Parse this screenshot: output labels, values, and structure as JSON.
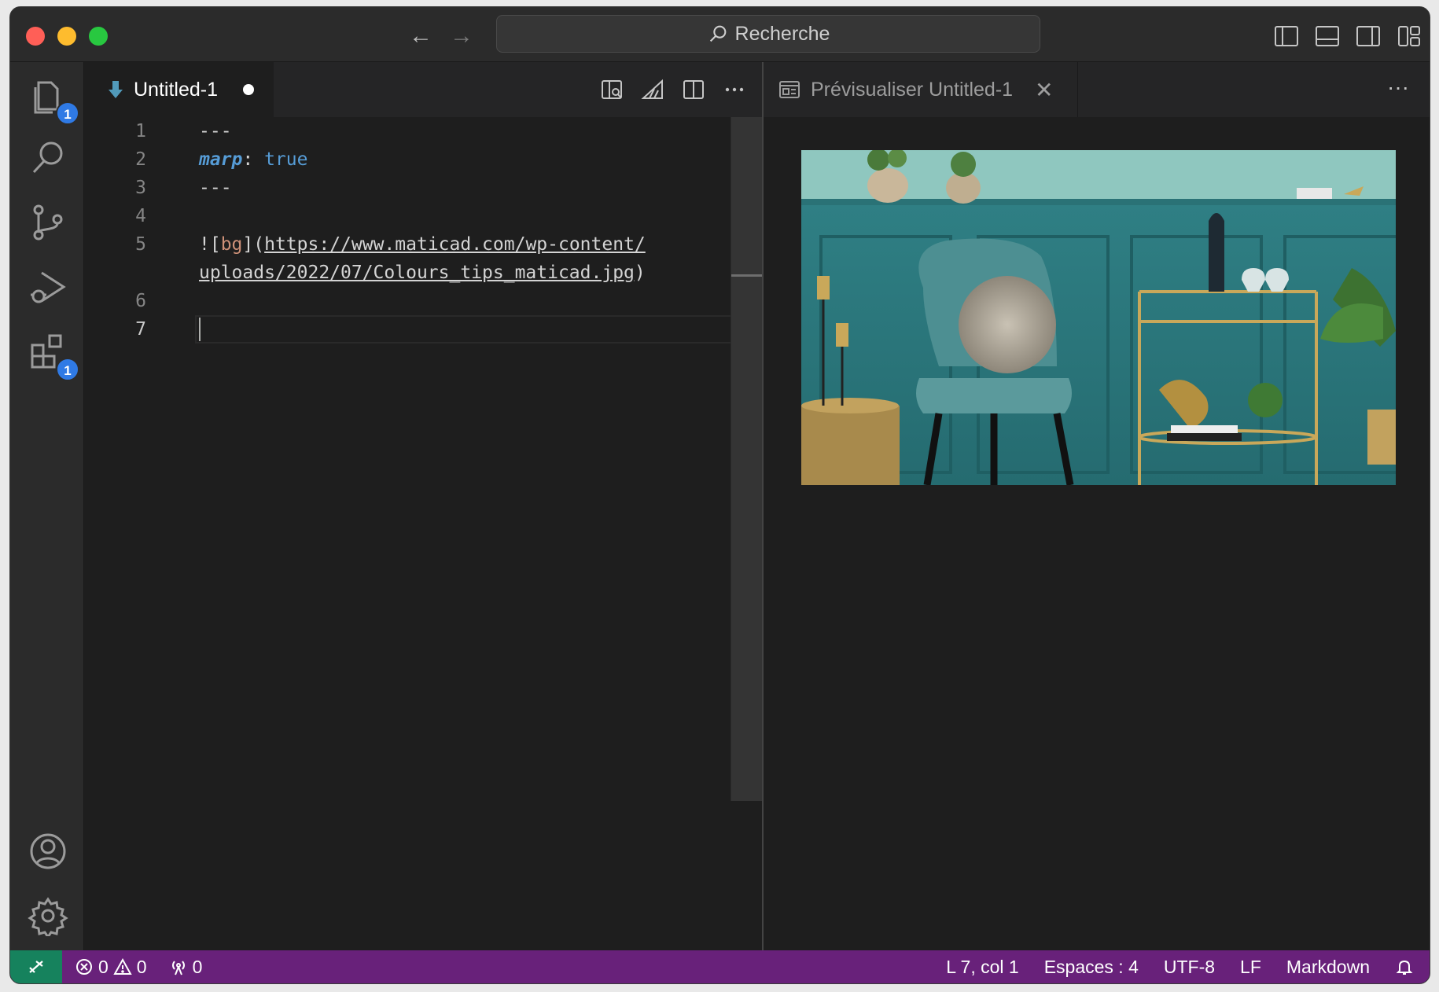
{
  "titlebar": {
    "search_label": "Recherche"
  },
  "activity_bar": {
    "explorer_badge": "1",
    "extensions_badge": "1"
  },
  "editor": {
    "tab_title": "Untitled-1",
    "lines": [
      {
        "num": "1",
        "text": "---"
      },
      {
        "num": "2",
        "key": "marp",
        "sep": ": ",
        "value": "true"
      },
      {
        "num": "3",
        "text": "---"
      },
      {
        "num": "4",
        "text": ""
      },
      {
        "num": "5",
        "pre": "![",
        "alt": "bg",
        "mid": "](",
        "url1": "https://www.maticad.com/wp-content/",
        "url2": "uploads/2022/07/Colours_tips_maticad.jpg",
        "post": ")"
      },
      {
        "num": "6",
        "text": ""
      },
      {
        "num": "7",
        "text": ""
      }
    ]
  },
  "preview": {
    "tab_title": "Prévisualiser Untitled-1",
    "more": "···"
  },
  "statusbar": {
    "errors": "0",
    "warnings": "0",
    "ports": "0",
    "position": "L 7, col 1",
    "spaces": "Espaces : 4",
    "encoding": "UTF-8",
    "eol": "LF",
    "language": "Markdown"
  },
  "colors": {
    "statusbar_bg": "#68217a",
    "remote_bg": "#16825d",
    "badge": "#2f7ae5",
    "keyword": "#569cd6",
    "string": "#ce9178"
  }
}
